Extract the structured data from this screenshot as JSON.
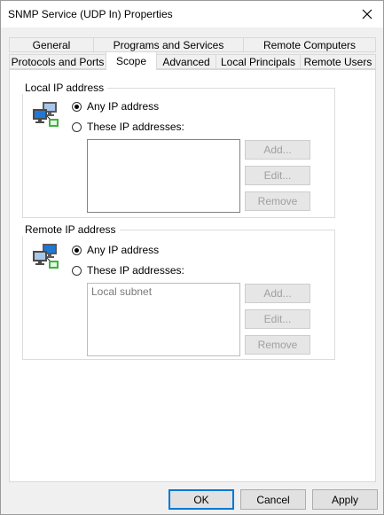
{
  "window": {
    "title": "SNMP Service (UDP In) Properties"
  },
  "tabs": {
    "row1": [
      {
        "label": "General"
      },
      {
        "label": "Programs and Services"
      },
      {
        "label": "Remote Computers"
      }
    ],
    "row2": [
      {
        "label": "Protocols and Ports"
      },
      {
        "label": "Scope"
      },
      {
        "label": "Advanced"
      },
      {
        "label": "Local Principals"
      },
      {
        "label": "Remote Users"
      }
    ],
    "active": "Scope"
  },
  "local_ip": {
    "title": "Local IP address",
    "any_label": "Any IP address",
    "these_label": "These IP addresses:",
    "selected": "any",
    "addresses": [],
    "buttons": {
      "add": "Add...",
      "edit": "Edit...",
      "remove": "Remove"
    }
  },
  "remote_ip": {
    "title": "Remote IP address",
    "any_label": "Any IP address",
    "these_label": "These IP addresses:",
    "selected": "any",
    "addresses": [
      "Local subnet"
    ],
    "buttons": {
      "add": "Add...",
      "edit": "Edit...",
      "remove": "Remove"
    }
  },
  "footer": {
    "ok": "OK",
    "cancel": "Cancel",
    "apply": "Apply"
  },
  "icons": {
    "window_close": "close-icon",
    "network": "network-computers-icon"
  },
  "colors": {
    "accent": "#0078d7",
    "disabled_text": "#a0a0a0"
  }
}
